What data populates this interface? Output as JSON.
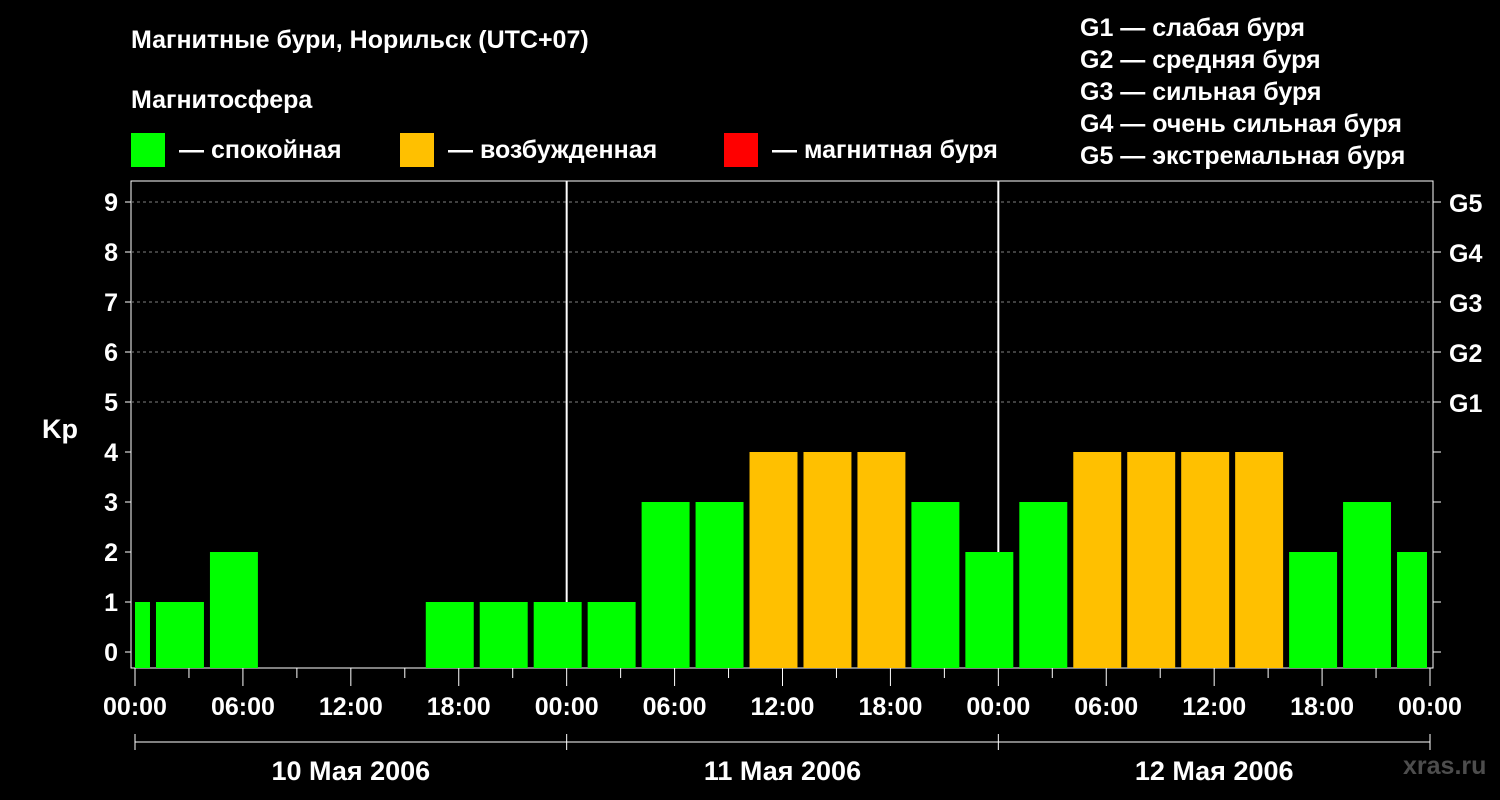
{
  "title": "Магнитные бури, Норильск (UTC+07)",
  "subtitle": "Магнитосфера",
  "legend": [
    {
      "label": "— спокойная",
      "color": "#00ff00"
    },
    {
      "label": "— возбужденная",
      "color": "#ffc000"
    },
    {
      "label": "— магнитная буря",
      "color": "#ff0000"
    }
  ],
  "g_legend": [
    "G1 — слабая буря",
    "G2 — средняя буря",
    "G3 — сильная буря",
    "G4 — очень сильная буря",
    "G5 — экстремальная буря"
  ],
  "watermark": "xras.ru",
  "chart_data": {
    "type": "bar",
    "ylabel": "Kp",
    "ylim": [
      0,
      9
    ],
    "yticks": [
      "0",
      "1",
      "2",
      "3",
      "4",
      "5",
      "6",
      "7",
      "8",
      "9"
    ],
    "g_scale": [
      {
        "label": "G1",
        "kp": 5
      },
      {
        "label": "G2",
        "kp": 6
      },
      {
        "label": "G3",
        "kp": 7
      },
      {
        "label": "G4",
        "kp": 8
      },
      {
        "label": "G5",
        "kp": 9
      }
    ],
    "x_time_labels": [
      "00:00",
      "06:00",
      "12:00",
      "18:00",
      "00:00",
      "06:00",
      "12:00",
      "18:00",
      "00:00",
      "06:00",
      "12:00",
      "18:00",
      "00:00"
    ],
    "days": [
      "10 Мая 2006",
      "11 Мая 2006",
      "12 Мая 2006"
    ],
    "grid": true,
    "colors": {
      "quiet": "#00ff00",
      "active": "#ffc000",
      "storm": "#ff0000"
    },
    "bars": [
      {
        "start": "10 Мая 00:00",
        "end": "10 Мая 01:00",
        "kp": 1,
        "level": "quiet"
      },
      {
        "start": "10 Мая 01:00",
        "end": "10 Мая 04:00",
        "kp": 1,
        "level": "quiet"
      },
      {
        "start": "10 Мая 04:00",
        "end": "10 Мая 07:00",
        "kp": 2,
        "level": "quiet"
      },
      {
        "start": "10 Мая 07:00",
        "end": "10 Мая 10:00",
        "kp": 0,
        "level": "quiet"
      },
      {
        "start": "10 Мая 10:00",
        "end": "10 Мая 13:00",
        "kp": 0,
        "level": "quiet"
      },
      {
        "start": "10 Мая 13:00",
        "end": "10 Мая 16:00",
        "kp": 0,
        "level": "quiet"
      },
      {
        "start": "10 Мая 16:00",
        "end": "10 Мая 19:00",
        "kp": 1,
        "level": "quiet"
      },
      {
        "start": "10 Мая 19:00",
        "end": "10 Мая 22:00",
        "kp": 1,
        "level": "quiet"
      },
      {
        "start": "10 Мая 22:00",
        "end": "11 Мая 01:00",
        "kp": 1,
        "level": "quiet"
      },
      {
        "start": "11 Мая 01:00",
        "end": "11 Мая 04:00",
        "kp": 1,
        "level": "quiet"
      },
      {
        "start": "11 Мая 04:00",
        "end": "11 Мая 07:00",
        "kp": 3,
        "level": "quiet"
      },
      {
        "start": "11 Мая 07:00",
        "end": "11 Мая 10:00",
        "kp": 3,
        "level": "quiet"
      },
      {
        "start": "11 Мая 10:00",
        "end": "11 Мая 13:00",
        "kp": 4,
        "level": "active"
      },
      {
        "start": "11 Мая 13:00",
        "end": "11 Мая 16:00",
        "kp": 4,
        "level": "active"
      },
      {
        "start": "11 Мая 16:00",
        "end": "11 Мая 19:00",
        "kp": 4,
        "level": "active"
      },
      {
        "start": "11 Мая 19:00",
        "end": "11 Мая 22:00",
        "kp": 3,
        "level": "quiet"
      },
      {
        "start": "11 Мая 22:00",
        "end": "12 Мая 01:00",
        "kp": 2,
        "level": "quiet"
      },
      {
        "start": "12 Мая 01:00",
        "end": "12 Мая 04:00",
        "kp": 3,
        "level": "quiet"
      },
      {
        "start": "12 Мая 04:00",
        "end": "12 Мая 07:00",
        "kp": 4,
        "level": "active"
      },
      {
        "start": "12 Мая 07:00",
        "end": "12 Мая 10:00",
        "kp": 4,
        "level": "active"
      },
      {
        "start": "12 Мая 10:00",
        "end": "12 Мая 13:00",
        "kp": 4,
        "level": "active"
      },
      {
        "start": "12 Мая 13:00",
        "end": "12 Мая 16:00",
        "kp": 4,
        "level": "active"
      },
      {
        "start": "12 Мая 16:00",
        "end": "12 Мая 19:00",
        "kp": 2,
        "level": "quiet"
      },
      {
        "start": "12 Мая 19:00",
        "end": "12 Мая 22:00",
        "kp": 3,
        "level": "quiet"
      },
      {
        "start": "12 Мая 22:00",
        "end": "13 Мая 00:00",
        "kp": 2,
        "level": "quiet"
      }
    ]
  }
}
